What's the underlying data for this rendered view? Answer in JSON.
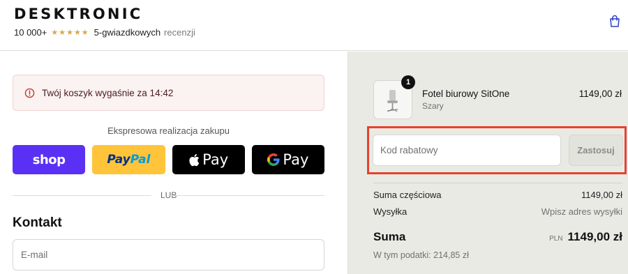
{
  "header": {
    "logo": "DESKTRONIC",
    "rating_count": "10 000+",
    "stars": "★★★★★",
    "rating_sub": "5-gwiazdkowych",
    "rating_muted": "recenzji",
    "cart_icon": "shopping-bag-icon"
  },
  "alert": {
    "icon": "alert-circle-icon",
    "text": "Twój koszyk wygaśnie za 14:42"
  },
  "express": {
    "title": "Ekspresowa realizacja zakupu",
    "shop_label": "shop",
    "paypal_part1": "Pay",
    "paypal_part2": "Pal",
    "apple_label": "Pay",
    "google_label": "Pay",
    "divider_label": "LUB"
  },
  "contact": {
    "heading": "Kontakt",
    "email_placeholder": "E-mail"
  },
  "order": {
    "item": {
      "quantity": "1",
      "name": "Fotel biurowy SitOne",
      "variant": "Szary",
      "price": "1149,00 zł"
    },
    "discount": {
      "placeholder": "Kod rabatowy",
      "apply_label": "Zastosuj"
    },
    "subtotal_label": "Suma częściowa",
    "subtotal_value": "1149,00 zł",
    "shipping_label": "Wysyłka",
    "shipping_value": "Wpisz adres wysyłki",
    "total_label": "Suma",
    "total_currency": "PLN",
    "total_value": "1149,00 zł",
    "tax_text": "W tym podatki: 214,85 zł"
  },
  "colors": {
    "shop_brand": "#5a31f4",
    "paypal_yellow": "#ffc439",
    "highlight_frame": "#e8412c",
    "summary_bg": "#eaeae5"
  }
}
